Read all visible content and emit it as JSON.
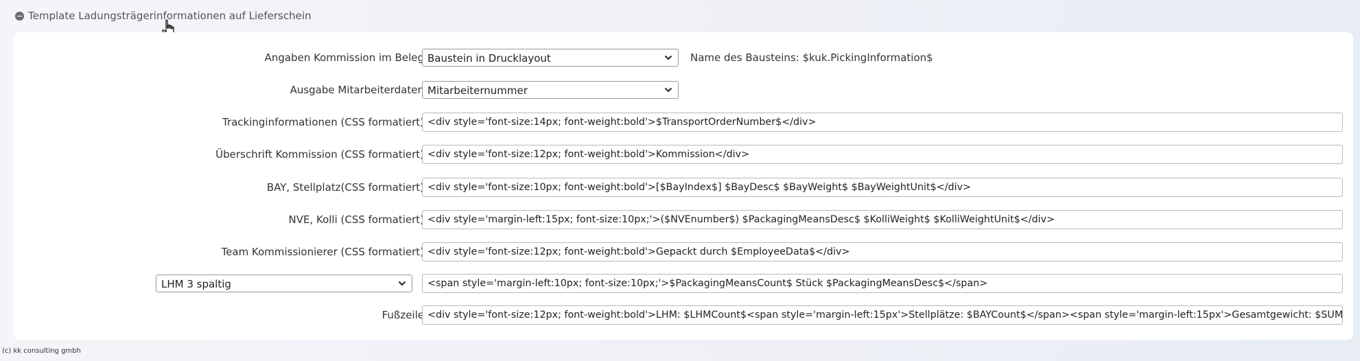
{
  "section": {
    "title": "Template Ladungsträgerinformationen auf Lieferschein"
  },
  "rows": [
    {
      "label": "Angaben Kommission im Beleg",
      "select_value": "Baustein in Drucklayout",
      "info": "Name des Bausteins: $kuk.PickingInformation$"
    },
    {
      "label": "Ausgabe Mitarbeiterdaten",
      "select_value": "Mitarbeiternummer"
    },
    {
      "label": "Trackinginformationen (CSS formatiert)",
      "value": "<div style='font-size:14px; font-weight:bold'>$TransportOrderNumber$</div>"
    },
    {
      "label": "Überschrift Kommission (CSS formatiert)",
      "value": "<div style='font-size:12px; font-weight:bold'>Kommission</div>"
    },
    {
      "label": "BAY, Stellplatz(CSS formatiert)",
      "value": "<div style='font-size:10px;  font-weight:bold'>[$BayIndex$] $BayDesc$ $BayWeight$ $BayWeightUnit$</div>"
    },
    {
      "label": "NVE, Kolli (CSS formatiert)",
      "value": "<div style='margin-left:15px; font-size:10px;'>($NVEnumber$) $PackagingMeansDesc$ $KolliWeight$ $KolliWeightUnit$</div>"
    },
    {
      "label": "Team Kommissionierer (CSS formatiert)",
      "value": "<div style='font-size:12px;  font-weight:bold'>Gepackt durch $EmployeeData$</div>"
    },
    {
      "select_value": "LHM 3 spaltig",
      "value": "<span style='margin-left:10px; font-size:10px;'>$PackagingMeansCount$ Stück $PackagingMeansDesc$</span>"
    },
    {
      "label": "Fußzeile",
      "value": "<div style='font-size:12px;  font-weight:bold'>LHM: $LHMCount$<span style='margin-left:15px'>Stellplätze: $BAYCount$</span><span style='margin-left:15px'>Gesamtgewicht: $SUMWeight$</span></div>"
    }
  ],
  "footer": {
    "copyright": "(c) kk consulting gmbh"
  },
  "icons": {
    "collapse": "minus-circle-icon",
    "cursor": "hand-pointer-icon",
    "dropdown": "chevron-down-icon"
  }
}
